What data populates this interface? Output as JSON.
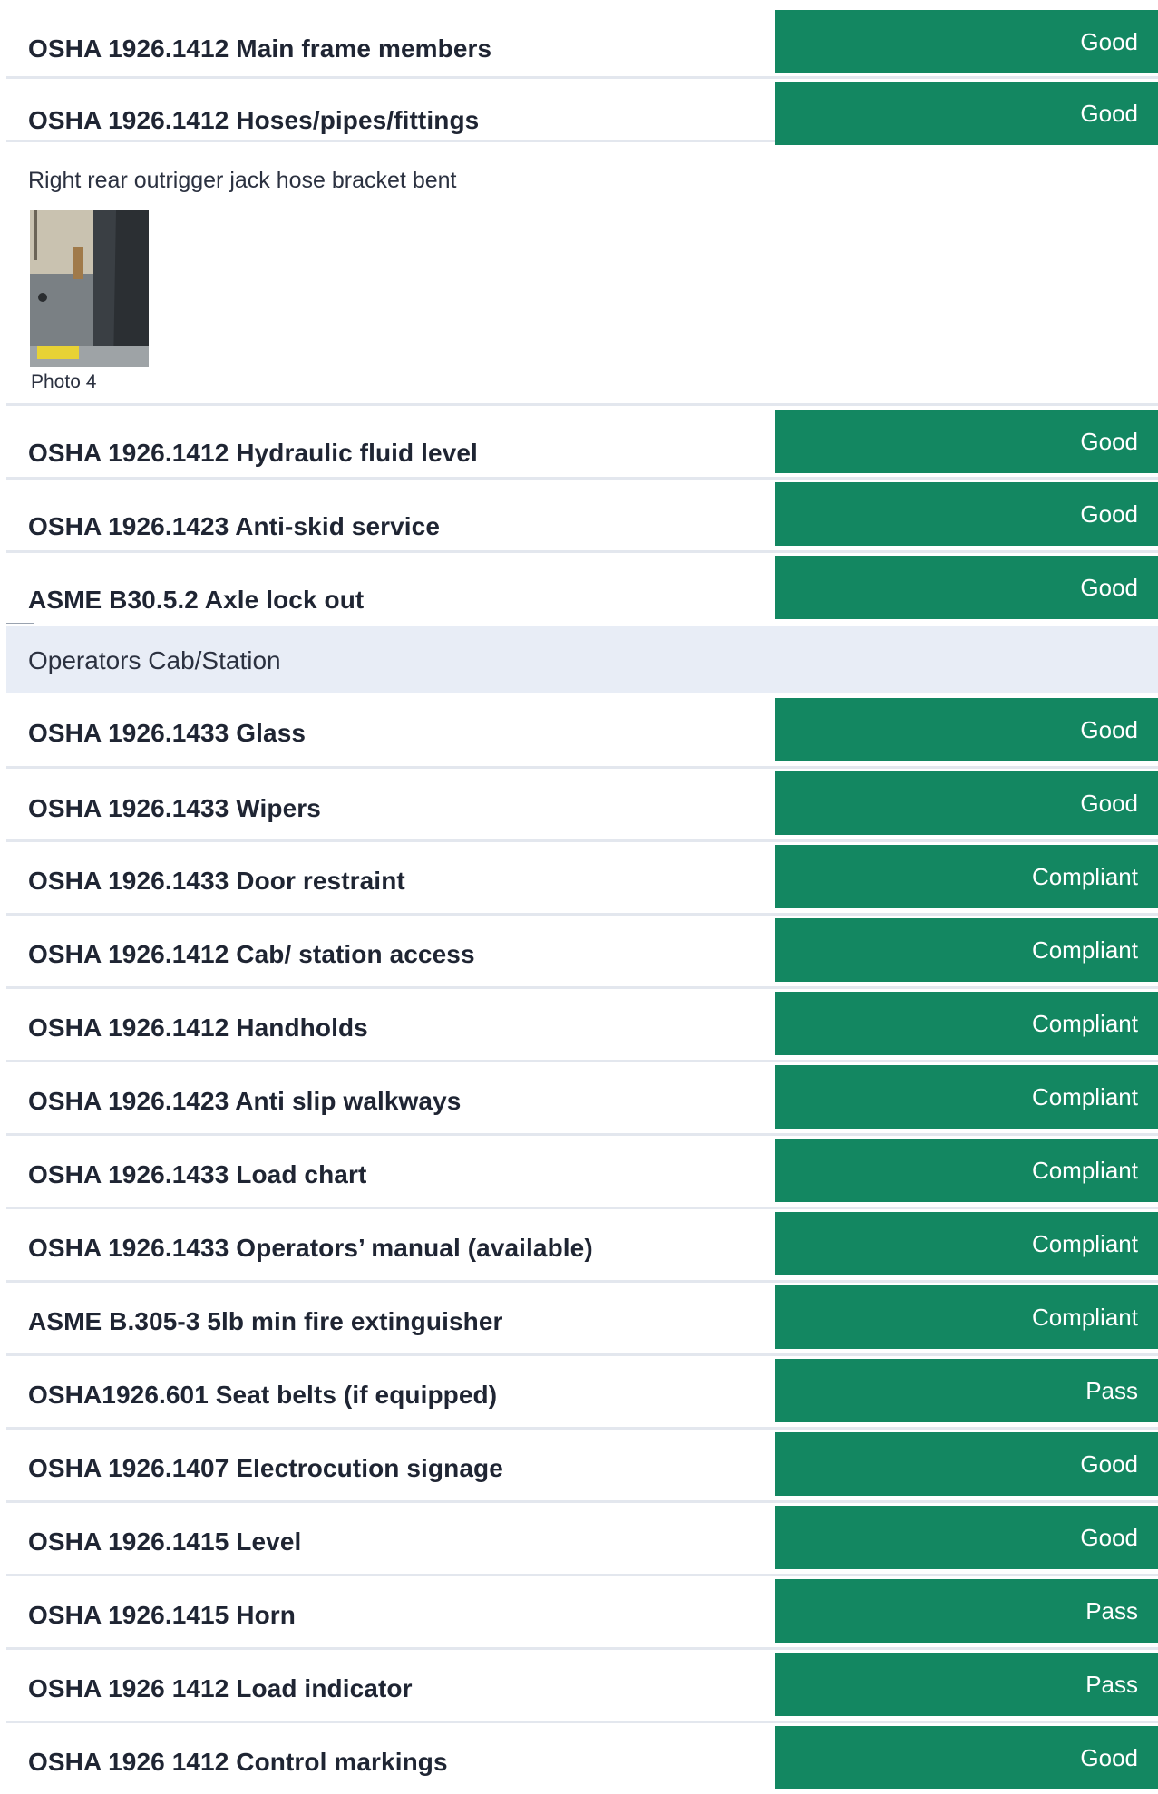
{
  "rows_top": [
    {
      "label": "OSHA 1926.1412 Main frame members",
      "status": "Good"
    },
    {
      "label": "OSHA 1926.1412 Hoses/pipes/fittings",
      "status": "Good"
    }
  ],
  "note": {
    "text": "Right rear outrigger jack hose bracket bent",
    "photo_caption": "Photo 4"
  },
  "rows_middle": [
    {
      "label": "OSHA 1926.1412 Hydraulic fluid level",
      "status": "Good"
    },
    {
      "label": "OSHA 1926.1423 Anti-skid service",
      "status": "Good"
    },
    {
      "label": "ASME B30.5.2 Axle lock out",
      "status": "Good"
    }
  ],
  "section": {
    "title": "Operators Cab/Station"
  },
  "rows_cab": [
    {
      "label": "OSHA 1926.1433 Glass",
      "status": "Good"
    },
    {
      "label": "OSHA 1926.1433 Wipers",
      "status": "Good"
    },
    {
      "label": "OSHA 1926.1433 Door restraint",
      "status": "Compliant"
    },
    {
      "label": "OSHA 1926.1412 Cab/ station access",
      "status": "Compliant"
    },
    {
      "label": "OSHA 1926.1412 Handholds",
      "status": "Compliant"
    },
    {
      "label": "OSHA 1926.1423 Anti slip walkways",
      "status": "Compliant"
    },
    {
      "label": "OSHA 1926.1433 Load chart",
      "status": "Compliant"
    },
    {
      "label": "OSHA 1926.1433 Operators’ manual (available)",
      "status": "Compliant"
    },
    {
      "label": "ASME B.305-3 5lb min fire extinguisher",
      "status": "Compliant"
    },
    {
      "label": "OSHA1926.601 Seat belts (if equipped)",
      "status": "Pass"
    },
    {
      "label": "OSHA 1926.1407 Electrocution signage",
      "status": "Good"
    },
    {
      "label": "OSHA 1926.1415 Level",
      "status": "Good"
    },
    {
      "label": "OSHA 1926.1415 Horn",
      "status": "Pass"
    },
    {
      "label": "OSHA 1926 1412 Load indicator",
      "status": "Pass"
    },
    {
      "label": "OSHA 1926 1412 Control markings",
      "status": "Good"
    }
  ],
  "colors": {
    "status_bg": "#138761",
    "section_bg": "#e8edf6",
    "divider": "#e3e7ee"
  }
}
